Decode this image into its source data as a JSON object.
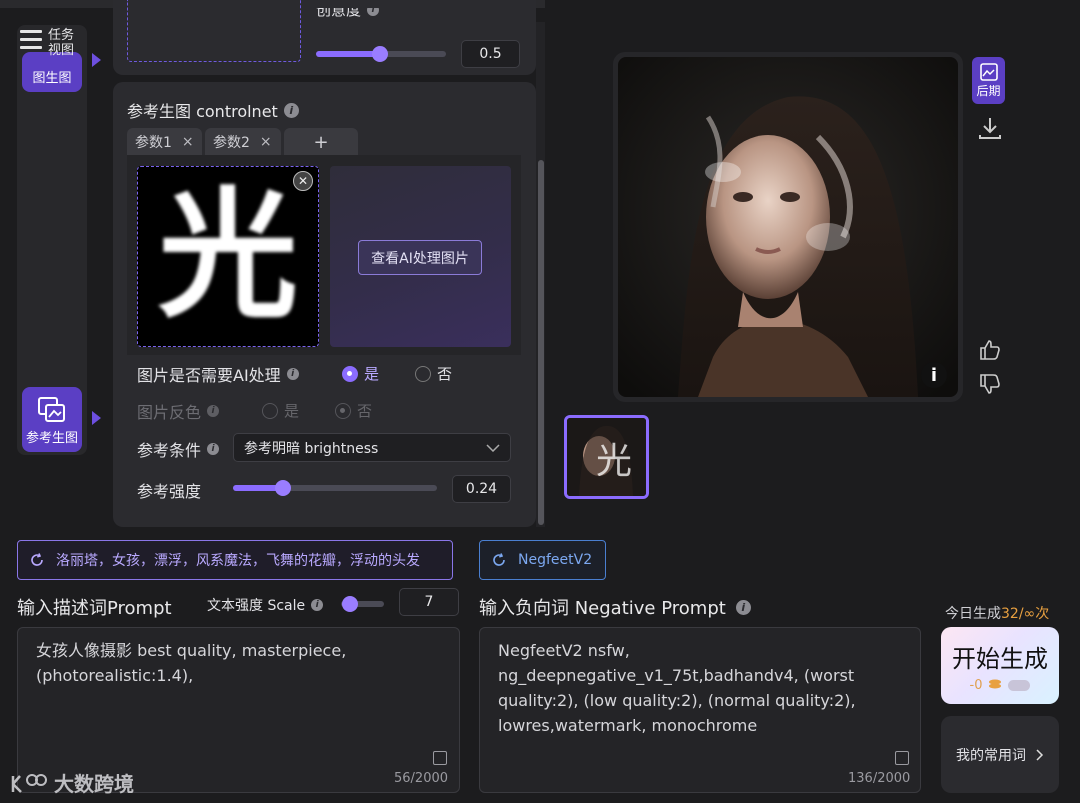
{
  "rail": {
    "menu_label": "任务视图",
    "img2img_label": "图生图",
    "ref_label": "参考生图"
  },
  "top_param": {
    "label": "创意度",
    "value": "0.5",
    "fraction": 0.5
  },
  "controlnet": {
    "title": "参考生图 controlnet",
    "tabs": [
      {
        "label": "参数1",
        "close": "×"
      },
      {
        "label": "参数2",
        "close": "×"
      }
    ],
    "add_tab": "+",
    "image_glyph": "光",
    "view_ai_button": "查看AI处理图片",
    "ai_process": {
      "label": "图片是否需要AI处理",
      "yes": "是",
      "no": "否",
      "selected": "是"
    },
    "invert": {
      "label": "图片反色",
      "yes": "是",
      "no": "否",
      "selected": "否"
    },
    "condition": {
      "label": "参考条件",
      "value": "参考明暗 brightness"
    },
    "strength": {
      "label": "参考强度",
      "value": "0.24",
      "fraction": 0.24
    }
  },
  "prompt": {
    "chip": "洛丽塔，女孩，漂浮，风系魔法，飞舞的花瓣，浮动的头发",
    "title": "输入描述词Prompt",
    "scale_label": "文本强度 Scale",
    "scale_value": "7",
    "scale_fraction": 0.35,
    "text": "女孩人像摄影 best quality, masterpiece, (photorealistic:1.4),",
    "counter": "56/2000"
  },
  "negative": {
    "chip": "NegfeetV2",
    "title": "输入负向词 Negative Prompt",
    "text": "NegfeetV2 nsfw, ng_deepnegative_v1_75t,badhandv4, (worst quality:2), (low quality:2), (normal quality:2), lowres,watermark, monochrome",
    "counter": "136/2000"
  },
  "right": {
    "post_label": "后期",
    "info": "i",
    "today_label": "今日生成",
    "today_count": "32",
    "today_limit": "/∞次",
    "generate": "开始生成",
    "cost": "-0",
    "favorites": "我的常用词"
  },
  "watermark": "大数跨境",
  "colors": {
    "accent": "#8b6cff",
    "rail_active": "#5b3fc4",
    "chip_blue": "#4a7fd0"
  }
}
